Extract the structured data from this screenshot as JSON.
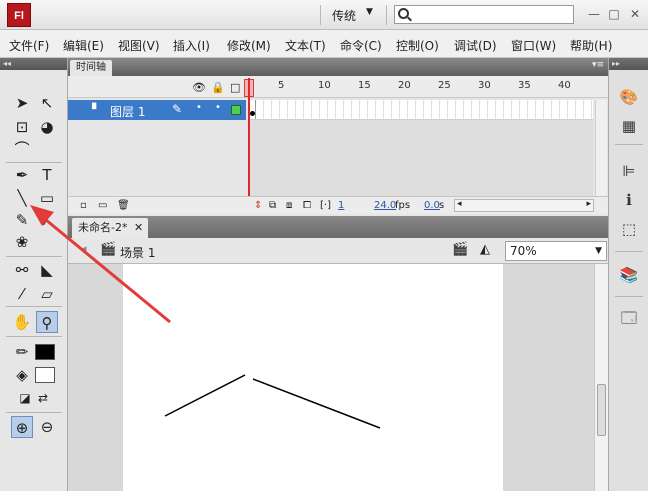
{
  "app": {
    "logo": "Fl",
    "workspace": "传统",
    "window_buttons": [
      "—",
      "□",
      "✕"
    ]
  },
  "menu": [
    "文件(F)",
    "编辑(E)",
    "视图(V)",
    "插入(I)",
    "修改(M)",
    "文本(T)",
    "命令(C)",
    "控制(O)",
    "调试(D)",
    "窗口(W)",
    "帮助(H)"
  ],
  "tools": {
    "panel_collapse": "◂◂",
    "items": [
      {
        "name": "selection-tool-icon",
        "glyph": "➤"
      },
      {
        "name": "subselection-tool-icon",
        "glyph": "↖"
      },
      {
        "name": "free-transform-tool-icon",
        "glyph": "⊡"
      },
      {
        "name": "3d-rotation-tool-icon",
        "glyph": "◕"
      },
      {
        "name": "lasso-tool-icon",
        "glyph": "⌒"
      },
      {
        "name": "pen-tool-icon",
        "glyph": "✒"
      },
      {
        "name": "text-tool-icon",
        "glyph": "T"
      },
      {
        "name": "line-tool-icon",
        "glyph": "╲"
      },
      {
        "name": "rectangle-tool-icon",
        "glyph": "▭"
      },
      {
        "name": "pencil-tool-icon",
        "glyph": "✎"
      },
      {
        "name": "brush-tool-icon",
        "glyph": "⁄"
      },
      {
        "name": "deco-tool-icon",
        "glyph": "❀"
      },
      {
        "name": "bone-tool-icon",
        "glyph": "⚯"
      },
      {
        "name": "paint-bucket-tool-icon",
        "glyph": "◣"
      },
      {
        "name": "eyedropper-tool-icon",
        "glyph": "⁄"
      },
      {
        "name": "eraser-tool-icon",
        "glyph": "▱"
      },
      {
        "name": "hand-tool-icon",
        "glyph": "✋"
      },
      {
        "name": "zoom-tool-icon",
        "glyph": "⚲"
      },
      {
        "name": "stroke-color-icon",
        "glyph": "✏"
      },
      {
        "name": "fill-color-icon",
        "glyph": "◈"
      },
      {
        "name": "default-colors-icon",
        "glyph": "◪"
      },
      {
        "name": "swap-colors-icon",
        "glyph": "⇄"
      },
      {
        "name": "zoom-in-option-icon",
        "glyph": "⊕"
      },
      {
        "name": "zoom-out-option-icon",
        "glyph": "⊖"
      }
    ],
    "stroke_color": "#000000",
    "fill_color": "#ffffff"
  },
  "timeline": {
    "tab_label": "时间轴",
    "options_icon": "▾≡",
    "header_icons": [
      "👁",
      "🔒",
      "□"
    ],
    "frame_numbers": [
      "1",
      "5",
      "10",
      "15",
      "20",
      "25",
      "30",
      "35",
      "40"
    ],
    "layer_name": "图层 1",
    "current_frame": "1",
    "fps": "24.0",
    "fps_unit": "fps",
    "elapsed": "0.0",
    "elapsed_unit": "s",
    "layer_outline_color": "#4fcf4f"
  },
  "document": {
    "tab_label": "未命名-2*",
    "scene_label": "场景 1",
    "zoom_value": "70%"
  },
  "colors": {
    "annotation_arrow": "#e23b3b",
    "layer_highlight": "#3b79c9"
  },
  "stage_drawing": "two black line segments forming a roof-like angle"
}
